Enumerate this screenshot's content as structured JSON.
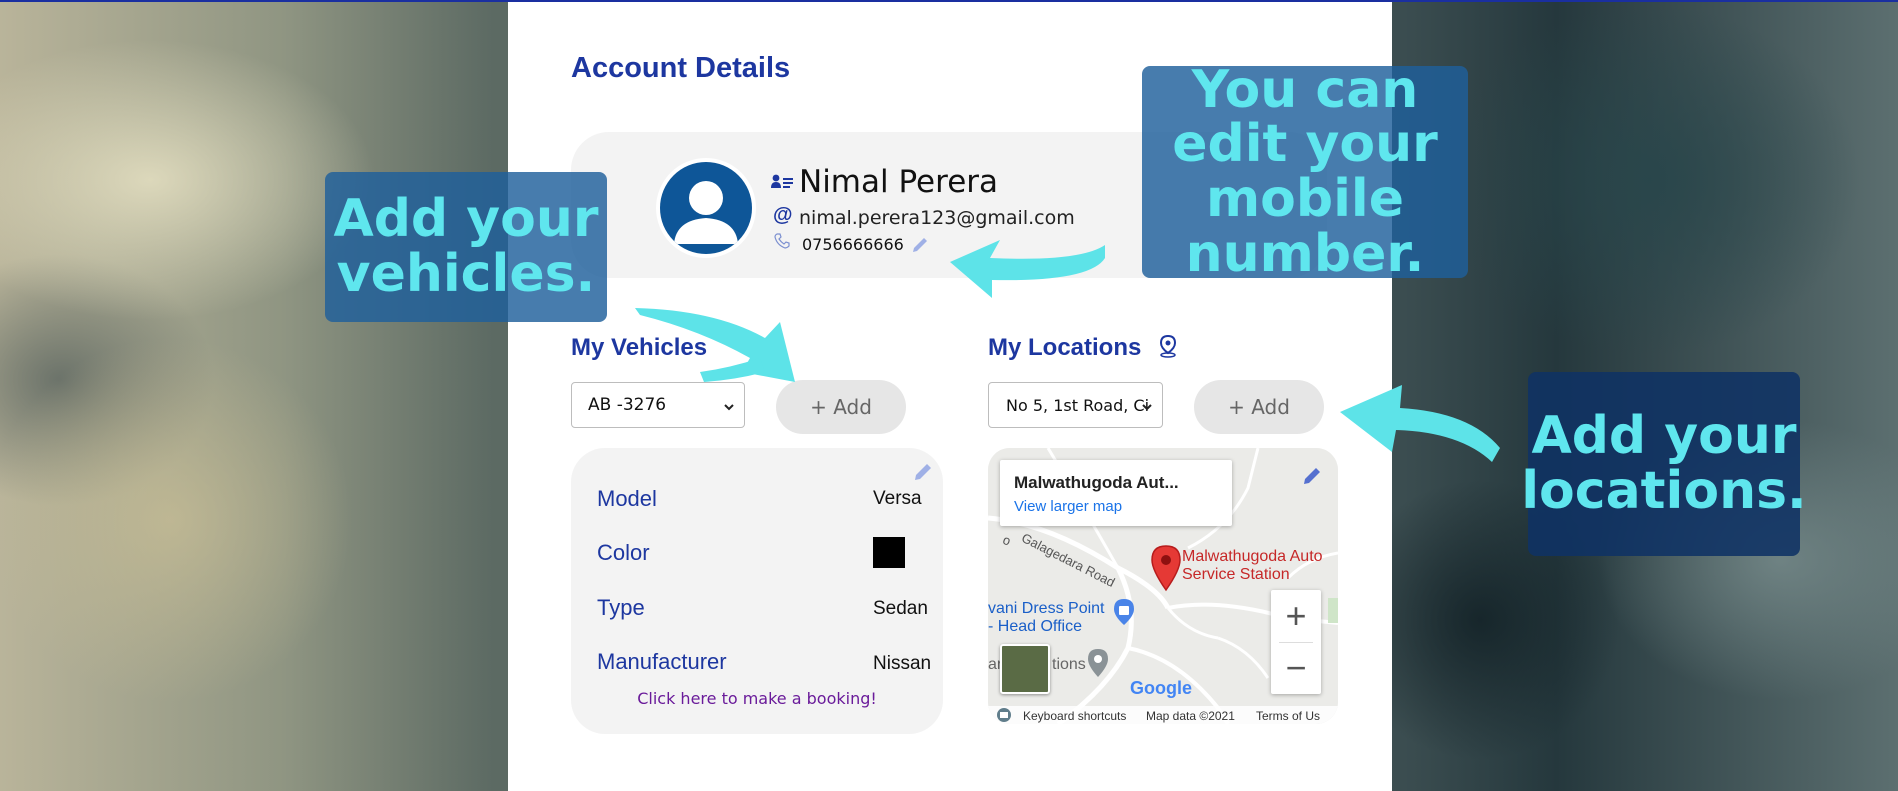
{
  "page": {
    "title": "Account Details"
  },
  "profile": {
    "name": "Nimal Perera",
    "email": "nimal.perera123@gmail.com",
    "phone": "0756666666"
  },
  "vehicles": {
    "title": "My Vehicles",
    "selected": "AB -3276",
    "add_label": "+ Add",
    "details": [
      {
        "label": "Model",
        "value": "Versa"
      },
      {
        "label": "Color",
        "value": ""
      },
      {
        "label": "Type",
        "value": "Sedan"
      },
      {
        "label": "Manufacturer",
        "value": "Nissan"
      }
    ],
    "color_swatch": "#000000",
    "booking_link": "Click here to make a booking!"
  },
  "locations": {
    "title": "My Locations",
    "selected": "No 5, 1st Road, Ci",
    "add_label": "+ Add",
    "map": {
      "place_title": "Malwathugoda Aut...",
      "larger_map": "View larger map",
      "road_label": "Galagedara Road",
      "road_prefix": "o",
      "pin_label_line1": "Malwathugoda Auto",
      "pin_label_line2": "Service Station",
      "poi_line1": "vani Dress Point",
      "poi_line2": "- Head Office",
      "poi_side": "ar",
      "poi_side2": "tions",
      "zoom_in": "+",
      "zoom_out": "−",
      "logo": "Google",
      "shortcuts": "Keyboard shortcuts",
      "map_data": "Map data ©2021",
      "terms": "Terms of Us"
    }
  },
  "callouts": {
    "mobile": "You can edit your mobile number.",
    "vehicles": "Add your vehicles.",
    "locations": "Add your locations."
  },
  "colors": {
    "accent": "#1d37a0",
    "callout_text": "#5fe6ee",
    "callout_bg": "#1e5f9b",
    "avatar_bg": "#0e5698",
    "arrow": "#5de3e8"
  },
  "icons": {
    "name": "user-card-icon",
    "email": "at-icon",
    "phone": "phone-icon",
    "edit": "pencil-icon",
    "location": "location-pin-icon"
  }
}
